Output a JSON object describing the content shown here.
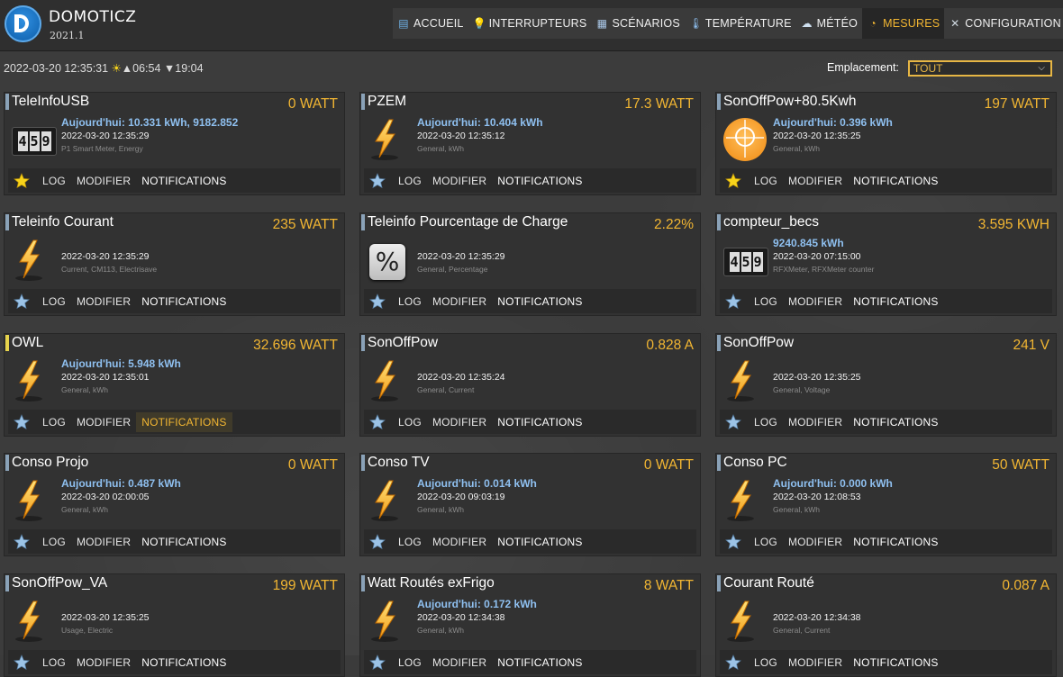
{
  "header": {
    "brand": "DOMOTICZ",
    "version": "2021.1",
    "nav": [
      {
        "label": "ACCUEIL",
        "icon": "dashboard-icon"
      },
      {
        "label": "INTERRUPTEURS",
        "icon": "lightbulb-icon"
      },
      {
        "label": "SCÉNARIOS",
        "icon": "scenes-icon"
      },
      {
        "label": "TEMPÉRATURE",
        "icon": "thermometer-icon"
      },
      {
        "label": "MÉTÉO",
        "icon": "weather-icon"
      },
      {
        "label": "MESURES",
        "icon": "gauge-icon",
        "active": true
      },
      {
        "label": "CONFIGURATION",
        "icon": "tools-icon"
      }
    ]
  },
  "status": {
    "datetime": "2022-03-20 12:35:31",
    "sunrise": "06:54",
    "sunset": "19:04"
  },
  "location": {
    "label": "Emplacement:",
    "selected": "TOUT"
  },
  "actions": {
    "log": "LOG",
    "edit": "MODIFIER",
    "notifications": "NOTIFICATIONS"
  },
  "devices": [
    {
      "name": "TeleInfoUSB",
      "value": "0 WATT",
      "line1": "Aujourd'hui: 10.331 kWh, 9182.852",
      "line2": "2022-03-20 12:35:29",
      "line3": "P1 Smart Meter, Energy",
      "icon": "counter",
      "star": "favorite"
    },
    {
      "name": "PZEM",
      "value": "17.3 WATT",
      "line1": "Aujourd'hui: 10.404 kWh",
      "line2": "2022-03-20 12:35:12",
      "line3": "General, kWh",
      "icon": "bolt",
      "star": "normal"
    },
    {
      "name": "SonOffPow+80.5Kwh",
      "value": "197 WATT",
      "line1": "Aujourd'hui: 0.396 kWh",
      "line2": "2022-03-20 12:35:25",
      "line3": "General, kWh",
      "icon": "sun",
      "star": "favorite"
    },
    {
      "name": "Teleinfo Courant",
      "value": "235 WATT",
      "line1": "",
      "line2": "2022-03-20 12:35:29",
      "line3": "Current, CM113, Electrisave",
      "icon": "bolt",
      "star": "normal"
    },
    {
      "name": "Teleinfo Pourcentage de Charge",
      "value": "2.22%",
      "line1": "",
      "line2": "2022-03-20 12:35:29",
      "line3": "General, Percentage",
      "icon": "percent",
      "star": "normal"
    },
    {
      "name": "compteur_becs",
      "value": "3.595 KWH",
      "line1": "9240.845 kWh",
      "line2": "2022-03-20 07:15:00",
      "line3": "RFXMeter, RFXMeter counter",
      "icon": "counter",
      "star": "normal"
    },
    {
      "name": "OWL",
      "value": "32.696 WATT",
      "line1": "Aujourd'hui: 5.948 kWh",
      "line2": "2022-03-20 12:35:01",
      "line3": "General, kWh",
      "icon": "bolt",
      "star": "normal",
      "bar": "yellow",
      "notif_highlight": true
    },
    {
      "name": "SonOffPow",
      "value": "0.828 A",
      "line1": "",
      "line2": "2022-03-20 12:35:24",
      "line3": "General, Current",
      "icon": "bolt",
      "star": "normal"
    },
    {
      "name": "SonOffPow",
      "value": "241 V",
      "line1": "",
      "line2": "2022-03-20 12:35:25",
      "line3": "General, Voltage",
      "icon": "bolt",
      "star": "normal"
    },
    {
      "name": "Conso Projo",
      "value": "0 WATT",
      "line1": "Aujourd'hui: 0.487 kWh",
      "line2": "2022-03-20 02:00:05",
      "line3": "General, kWh",
      "icon": "bolt",
      "star": "normal"
    },
    {
      "name": "Conso TV",
      "value": "0 WATT",
      "line1": "Aujourd'hui: 0.014 kWh",
      "line2": "2022-03-20 09:03:19",
      "line3": "General, kWh",
      "icon": "bolt",
      "star": "normal"
    },
    {
      "name": "Conso PC",
      "value": "50 WATT",
      "line1": "Aujourd'hui: 0.000 kWh",
      "line2": "2022-03-20 12:08:53",
      "line3": "General, kWh",
      "icon": "bolt",
      "star": "normal"
    },
    {
      "name": "SonOffPow_VA",
      "value": "199 WATT",
      "line1": "",
      "line2": "2022-03-20 12:35:25",
      "line3": "Usage, Electric",
      "icon": "bolt",
      "star": "normal"
    },
    {
      "name": "Watt Routés exFrigo",
      "value": "8 WATT",
      "line1": "Aujourd'hui: 0.172 kWh",
      "line2": "2022-03-20 12:34:38",
      "line3": "General, kWh",
      "icon": "bolt",
      "star": "normal"
    },
    {
      "name": "Courant Routé",
      "value": "0.087 A",
      "line1": "",
      "line2": "2022-03-20 12:34:38",
      "line3": "General, Current",
      "icon": "bolt",
      "star": "normal"
    }
  ],
  "colors": {
    "accent": "#f2b632",
    "info_blue": "#8fc0f0",
    "card_bg": "#323232",
    "page_bg": "#3b3b3b"
  }
}
